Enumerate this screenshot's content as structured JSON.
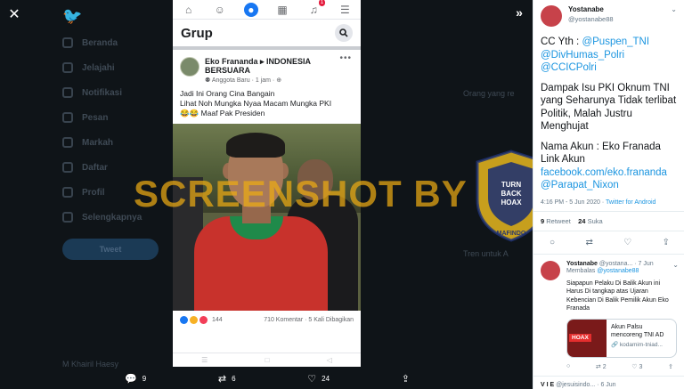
{
  "background": {
    "nav_items": [
      "Beranda",
      "Jelajahi",
      "Notifikasi",
      "Pesan",
      "Markah",
      "Daftar",
      "Profil",
      "Selengkapnya"
    ],
    "tweet_button": "Tweet",
    "user_name": "M Khairil Haesy",
    "right_items": [
      "Orang yang re",
      "Tren untuk A"
    ]
  },
  "viewer": {
    "close_icon": "close-icon",
    "expand_icon": "double-chevron-right-icon",
    "actions": {
      "reply_count": "9",
      "retweet_count": "6",
      "like_count": "24"
    }
  },
  "phone": {
    "nav_icons": [
      "home-icon",
      "friends-icon",
      "groups-icon",
      "marketplace-icon",
      "notifications-icon",
      "menu-icon"
    ],
    "notification_badge": "1",
    "header_title": "Grup",
    "post": {
      "author": "Eko Frananda",
      "group": "INDONESIA BERSUARA",
      "meta": "Anggota Baru · 1 jam ·",
      "text_lines": [
        "Jadi Ini Orang Cina Bangain",
        " Lihat Noh Mungka Nyaa Macam Mungka PKI",
        "😂😂 Maaf Pak Presiden"
      ],
      "reaction_count": "144",
      "comments": "710 Komentar",
      "shares": "5 Kali Dibagikan"
    }
  },
  "watermark": {
    "text": "SCREENSHOT BY",
    "badge_top": "MASYARAKAT ANTI FITNAH INDONESIA",
    "badge_mid": "TURN BACK HOAX",
    "badge_bottom": "MAFINDO",
    "color": "#ebaa14"
  },
  "tweet": {
    "name": "Yostanabe",
    "handle": "@yostanabe88",
    "line_cc": "CC Yth : ",
    "mention1": "@Puspen_TNI",
    "mention2": "@DivHumas_Polri",
    "mention3": "@CCICPolri",
    "para2": "Dampak Isu PKI Oknum TNI yang Seharunya Tidak terlibat Politik, Malah Justru Menghujat",
    "para3a": "Nama Akun : Eko Franada",
    "para3b": "Link Akun",
    "link": "facebook.com/eko.frananda",
    "mention4": "@Parapat_Nixon",
    "time": "4:16 PM - 5 Jun 2020 · ",
    "client": "Twitter for Android",
    "retweets": "9",
    "retweets_label": "Retweet",
    "likes": "24",
    "likes_label": "Suka",
    "accent": "#1b95e0"
  },
  "reply": {
    "name": "Yostanabe",
    "handle": "@yostana...",
    "date": "· 7 Jun",
    "replying_label": "Membalas ",
    "replying_to": "@yostanabe88",
    "text": "Siapapun Pelaku Di Balik Akun ini Harus Di tangkap atas Ujaran Kebencian Di Balik Pemilik Akun Eko Franada",
    "card_title": "Akun Palsu mencoreng TNI AD",
    "card_link": "kodamim-tniad...",
    "card_hoax": "HOAX",
    "retweets": "2",
    "likes": "3"
  },
  "reply2": {
    "name": "V I E",
    "handle": "@jesuisindo...",
    "date": "· 6 Jun"
  }
}
